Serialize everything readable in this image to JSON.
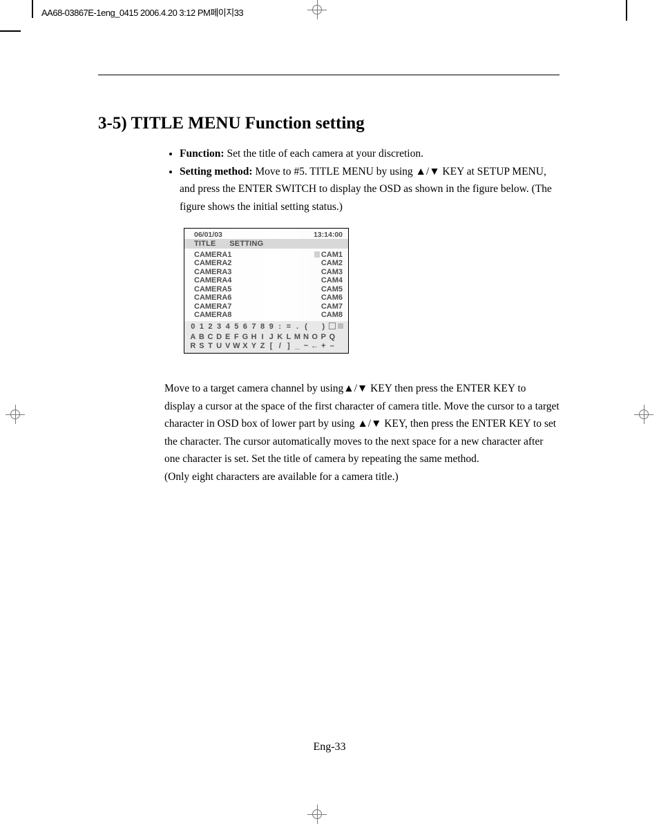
{
  "print_header": "AA68-03867E-1eng_0415  2006.4.20 3:12 PM페이지33",
  "heading": "3-5)    TITLE MENU Function setting",
  "bullet_function_label": "Function:",
  "bullet_function_text": "Set the title of each camera at your discretion.",
  "bullet_setting_label": "Setting method:",
  "bullet_setting_text_a": "Move to #5. TITLE MENU by using ▲/▼ KEY at SETUP MENU, and press the ENTER SWITCH to display the OSD as shown in the figure below. (The figure shows the initial setting status.)",
  "osd": {
    "date": "06/01/03",
    "time": "13:14:00",
    "header_left": "TITLE",
    "header_right": "SETTING",
    "cameras": [
      {
        "name": "CAMERA1",
        "value": "CAM1"
      },
      {
        "name": "CAMERA2",
        "value": "CAM2"
      },
      {
        "name": "CAMERA3",
        "value": "CAM3"
      },
      {
        "name": "CAMERA4",
        "value": "CAM4"
      },
      {
        "name": "CAMERA5",
        "value": "CAM5"
      },
      {
        "name": "CAMERA6",
        "value": "CAM6"
      },
      {
        "name": "CAMERA7",
        "value": "CAM7"
      },
      {
        "name": "CAMERA8",
        "value": "CAM8"
      }
    ],
    "grid_row1": [
      "0",
      "1",
      "2",
      "3",
      "4",
      "5",
      "6",
      "7",
      "8",
      "9",
      ":",
      "=",
      ".",
      "(",
      "",
      ")",
      "□",
      "■"
    ],
    "grid_row2": [
      "A",
      "B",
      "C",
      "D",
      "E",
      "F",
      "G",
      "H",
      "I",
      "J",
      "K",
      "L",
      "M",
      "N",
      "O",
      "P",
      "Q",
      ""
    ],
    "grid_row3": [
      "R",
      "S",
      "T",
      "U",
      "V",
      "W",
      "X",
      "Y",
      "Z",
      "[",
      "/",
      "]",
      "_",
      "~",
      "←",
      "+",
      "–",
      ""
    ]
  },
  "body_text_1": "Move to a target camera channel by using▲/▼ KEY then press the ENTER KEY to display   a cursor at the space of the first character of camera title. Move the cursor to a target character in OSD box of lower part by using ▲/▼ KEY, then press the ENTER KEY to set the character. The cursor automatically moves to the next space for a new character after one character is set. Set the title of camera by repeating the same method.",
  "body_text_2": "(Only eight characters are available for a camera title.)",
  "page_num": "Eng-33"
}
